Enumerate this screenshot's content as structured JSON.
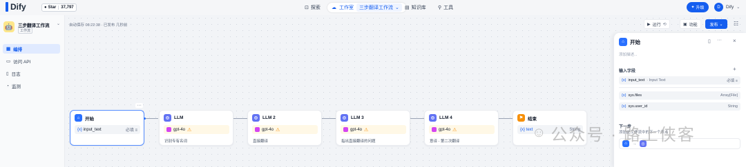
{
  "header": {
    "logo_text": "Dify",
    "github_label": "Star",
    "github_count": "37,797",
    "nav": [
      {
        "label": "探索",
        "icon": "compass-icon"
      },
      {
        "label": "工作室",
        "icon": "cloud-icon"
      },
      {
        "label": "知识库",
        "icon": "book-icon"
      },
      {
        "label": "工具",
        "icon": "tool-icon"
      }
    ],
    "current_app": "三步翻译工作流",
    "upgrade_label": "升级",
    "user_initial": "D",
    "user_name": "Dify"
  },
  "sidebar": {
    "app_name": "三步翻译工作流",
    "app_type": "工作流",
    "items": [
      {
        "label": "编排",
        "active": true
      },
      {
        "label": "访问 API",
        "active": false
      },
      {
        "label": "日志",
        "active": false
      },
      {
        "label": "监测",
        "active": false
      }
    ]
  },
  "canvas": {
    "autosave": "自动保存 08:22:38 · 已发布 几秒前",
    "toolbar": {
      "run_label": "运行",
      "features_label": "功能",
      "publish_label": "发布"
    },
    "nodes": [
      {
        "title": "开始",
        "icon_class": "start",
        "var": "input_text",
        "req": "必填",
        "desc": ""
      },
      {
        "title": "LLM",
        "icon_class": "llm",
        "model": "gpt-4o",
        "desc": "识别专有名词"
      },
      {
        "title": "LLM 2",
        "icon_class": "llm",
        "model": "gpt-4o",
        "desc": "直接翻译"
      },
      {
        "title": "LLM 3",
        "icon_class": "llm",
        "model": "gpt-4o",
        "desc": "指出直接翻译的问题"
      },
      {
        "title": "LLM 4",
        "icon_class": "llm",
        "model": "gpt-4o",
        "desc": "意译 - 第二次翻译"
      },
      {
        "title": "结束",
        "icon_class": "end",
        "output": "{x} text",
        "output_type": "String"
      }
    ]
  },
  "panel": {
    "title": "开始",
    "desc_placeholder": "添加描述...",
    "input_section": "输入字段",
    "inputs": [
      {
        "name": "input_text",
        "label": "· Input Text",
        "meta": "必填"
      }
    ],
    "sys_vars": [
      {
        "name": "sys.files",
        "type": "Array[File]"
      },
      {
        "name": "sys.user_id",
        "type": "String"
      }
    ],
    "next_section": "下一步",
    "next_desc": "添加此工作流中的下一个节点"
  },
  "watermark": "公众号 · 路上侠客"
}
